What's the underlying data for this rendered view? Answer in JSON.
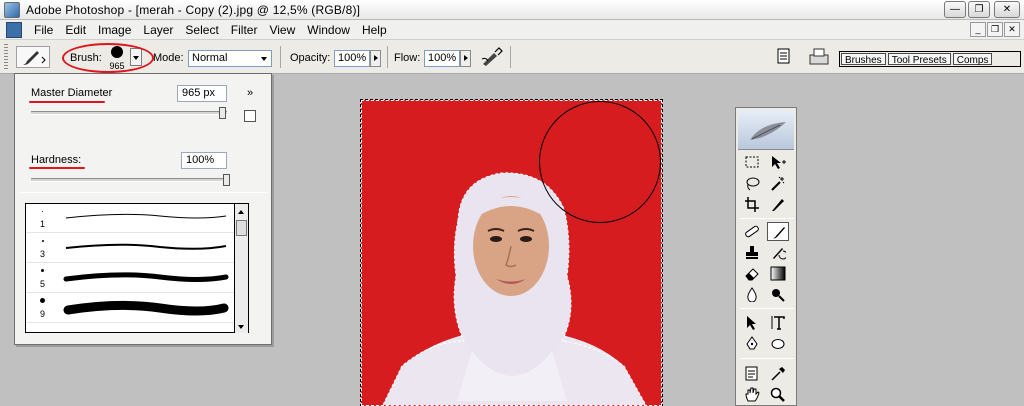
{
  "window": {
    "title": "Adobe Photoshop - [merah - Copy (2).jpg @ 12,5% (RGB/8)]",
    "minimize_label": "—",
    "maximize_label": "❐",
    "close_label": "✕"
  },
  "menu": {
    "items": [
      "File",
      "Edit",
      "Image",
      "Layer",
      "Select",
      "Filter",
      "View",
      "Window",
      "Help"
    ],
    "doc_minimize": "_",
    "doc_restore": "❐",
    "doc_close": "✕"
  },
  "options": {
    "brush_label": "Brush:",
    "brush_size": "965",
    "mode_label": "Mode:",
    "mode_value": "Normal",
    "opacity_label": "Opacity:",
    "opacity_value": "100%",
    "flow_label": "Flow:",
    "flow_value": "100%"
  },
  "palette_well": {
    "tabs": [
      "Brushes",
      "Tool Presets",
      "Comps"
    ]
  },
  "brush_picker": {
    "master_diameter_label": "Master Diameter",
    "master_diameter_value": "965 px",
    "master_diameter_level": 0.98,
    "hardness_label": "Hardness:",
    "hardness_value": "100%",
    "hardness_level": 1.0,
    "menu_glyph": "»",
    "presets": [
      {
        "size": "1"
      },
      {
        "size": "3"
      },
      {
        "size": "5"
      },
      {
        "size": "9"
      }
    ]
  },
  "colors": {
    "annotation_red": "#e0151d",
    "photo_background": "#d71c1f",
    "workspace": "#c0c0c0"
  }
}
